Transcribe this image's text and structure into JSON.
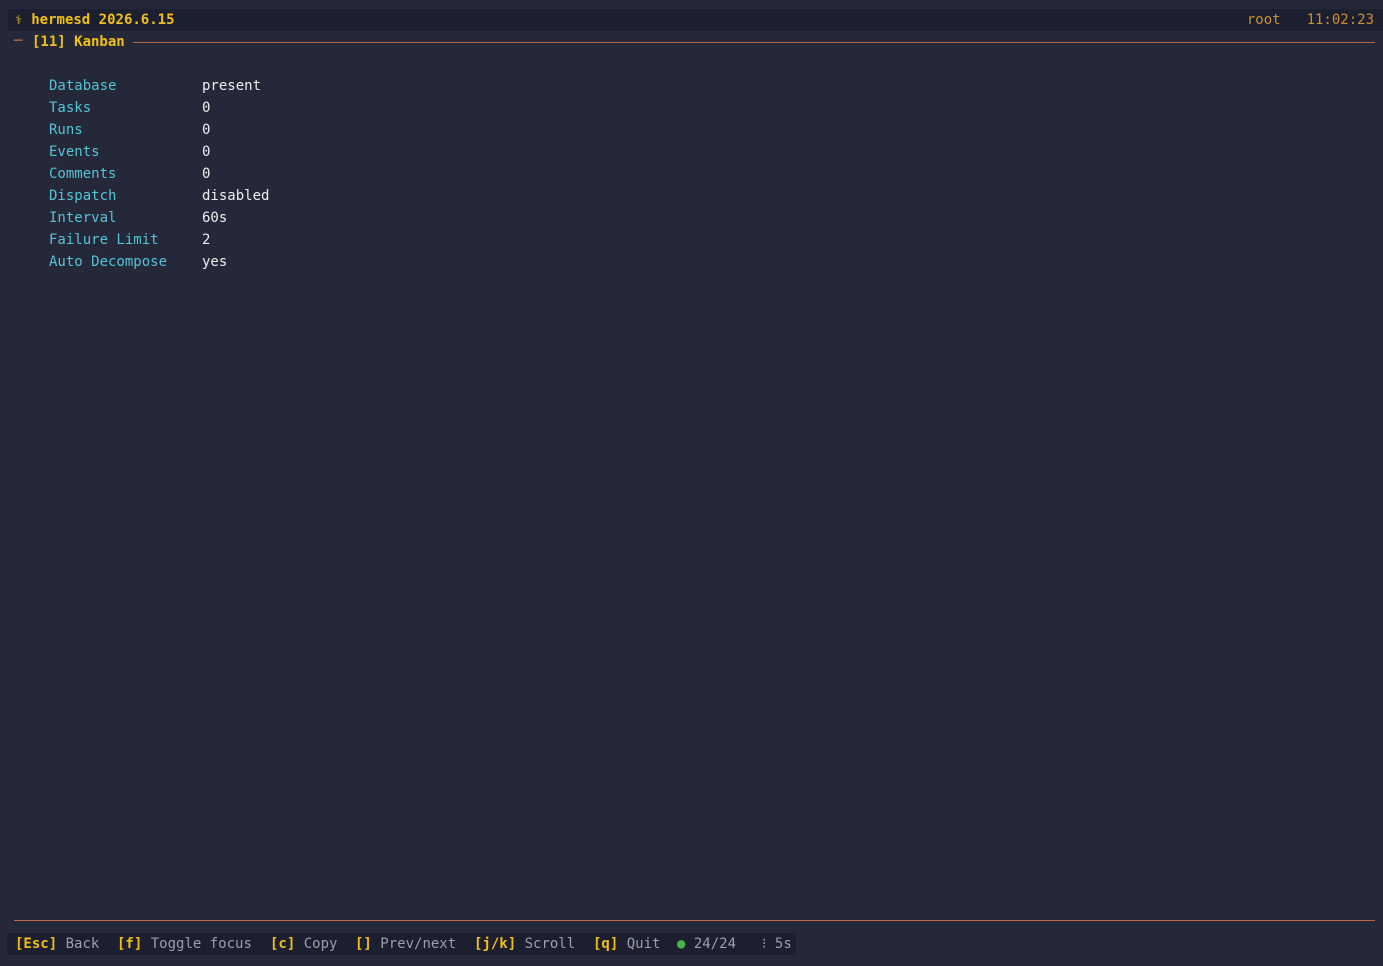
{
  "header": {
    "icon": "staff-icon",
    "glyph": "⚕",
    "app_title": "hermesd 2026.6.15",
    "user": "root",
    "time": "11:02:23"
  },
  "panel": {
    "dash": "─",
    "title": "[11] Kanban"
  },
  "fields": [
    {
      "key": "Database",
      "value": "present"
    },
    {
      "key": "Tasks",
      "value": "0"
    },
    {
      "key": "Runs",
      "value": "0"
    },
    {
      "key": "Events",
      "value": "0"
    },
    {
      "key": "Comments",
      "value": "0"
    },
    {
      "key": "Dispatch",
      "value": "disabled"
    },
    {
      "key": "Interval",
      "value": "60s"
    },
    {
      "key": "Failure Limit",
      "value": "2"
    },
    {
      "key": "Auto Decompose",
      "value": "yes"
    }
  ],
  "footer": {
    "shortcuts": [
      {
        "key": "[Esc]",
        "label": "Back"
      },
      {
        "key": "[f]",
        "label": "Toggle focus"
      },
      {
        "key": "[c]",
        "label": "Copy"
      },
      {
        "key": "[]",
        "label": "Prev/next"
      },
      {
        "key": "[j/k]",
        "label": "Scroll"
      },
      {
        "key": "[q]",
        "label": "Quit"
      }
    ],
    "status_dot": "●",
    "status_count": "24/24",
    "refresh_glyph": "⁝",
    "refresh_interval": "5s"
  },
  "colors": {
    "background": "#252839",
    "bar": "#1c1f30",
    "accent": "#f2c014",
    "key": "#52c4d6",
    "rule": "#b8693f",
    "ok": "#46b34b"
  }
}
